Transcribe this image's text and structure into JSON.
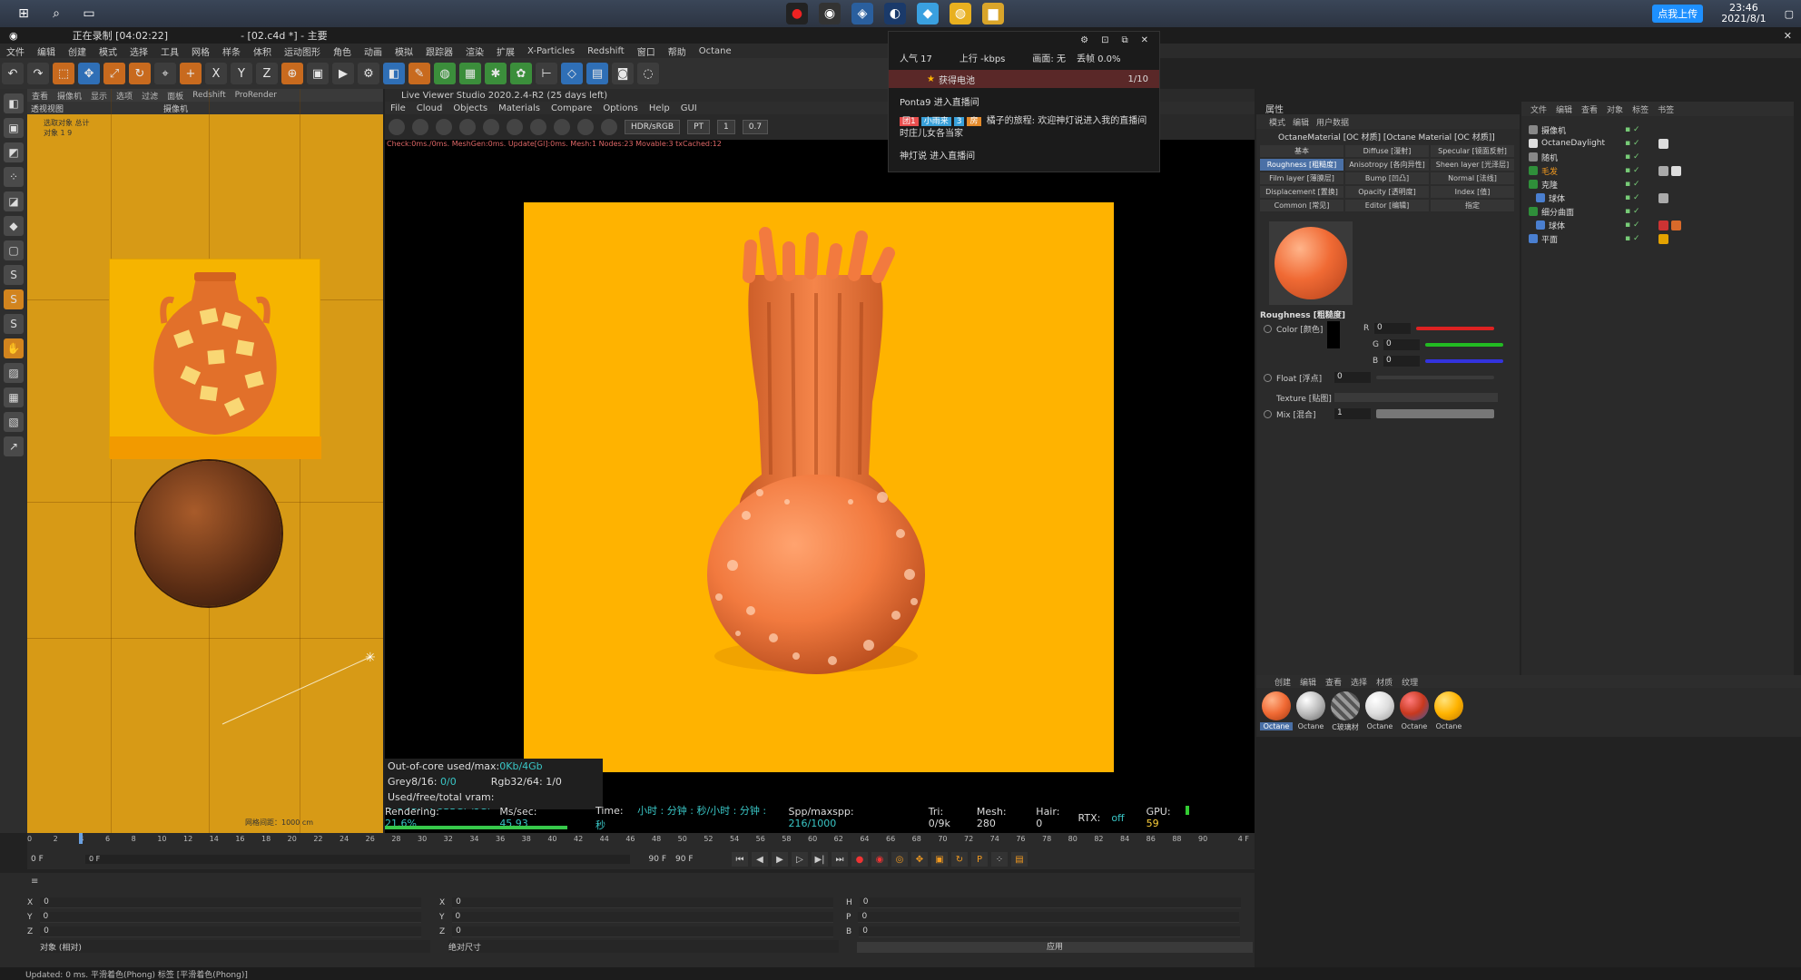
{
  "taskbar": {
    "time": "23:46",
    "date": "2021/8/1",
    "upload_label": "点我上传"
  },
  "titlebar": {
    "recording": "正在录制 [04:02:22]",
    "doc_title": "- [02.c4d *] - 主要"
  },
  "menu": [
    "文件",
    "编辑",
    "创建",
    "模式",
    "选择",
    "工具",
    "网格",
    "样条",
    "体积",
    "运动图形",
    "角色",
    "动画",
    "模拟",
    "跟踪器",
    "渲染",
    "扩展",
    "X-Particles",
    "Redshift",
    "窗口",
    "帮助",
    "Octane"
  ],
  "left_viewport": {
    "menu": [
      "查看",
      "摄像机",
      "显示",
      "选项",
      "过滤",
      "面板",
      "Redshift",
      "ProRender"
    ],
    "label": "透视视图",
    "camera": "摄像机",
    "selection_label": "选取对象 总计",
    "objects_row": "对象  1     9",
    "grid_spacing": "网格间距：1000 cm"
  },
  "viewer": {
    "title": "Live Viewer Studio 2020.2.4-R2 (25 days left)",
    "menu": [
      "File",
      "Cloud",
      "Objects",
      "Materials",
      "Compare",
      "Options",
      "Help",
      "GUI"
    ],
    "color_mode": "HDR/sRGB",
    "kernel": "PT",
    "value1": "1",
    "value2": "0.7",
    "status_line": "Check:0ms./0ms. MeshGen:0ms. Update[Gl]:0ms. Mesh:1 Nodes:23 Movable:3 txCached:12",
    "stats": {
      "out_of_core": "Out-of-core used/max:",
      "out_of_core_val": "0Kb/4Gb",
      "grey": "Grey8/16: ",
      "grey_val": "0/0",
      "rgb": "Rgb32/64: 1/0",
      "vram": "Used/free/total vram: ",
      "vram_val": "1.24Gb/4.855Gb/8Gb"
    },
    "render_bar": {
      "rendering": "Rendering: ",
      "rendering_val": "21.6%",
      "ms": "Ms/sec: ",
      "ms_val": "45.93",
      "time": "Time: ",
      "time_val": "小时 : 分钟 : 秒/小时 : 分钟 : 秒",
      "spp": "Spp/maxspp: ",
      "spp_val": "216/1000",
      "tri": "Tri: 0/9k",
      "mesh": "Mesh: 280",
      "hair": "Hair: 0",
      "rtx": "RTX:",
      "rtx_val": "off",
      "gpu": "GPU:",
      "gpu_val": "59"
    },
    "progress": 0.216
  },
  "overlay": {
    "popularity": "人气  17",
    "upload": "上行  -kbps",
    "screen": "画面: 无",
    "dropped": "丢帧 0.0%",
    "gift": "获得电池",
    "gift_count": "1/10",
    "user1": "Ponta9 进入直播间",
    "chat_tag1": "团1",
    "chat_tag2": "小雨来",
    "chat_tag3": "3",
    "chat_tag4": "房",
    "chat_msg": "橘子的旅程: 欢迎神灯说进入我的直播间时庄儿女各当家",
    "user2": "神灯说 进入直播间"
  },
  "attributes": {
    "header": "属性",
    "menu": [
      "模式",
      "编辑",
      "用户数据"
    ],
    "title": "OctaneMaterial [OC 材质] [Octane Material [OC 材质]]",
    "tabs": [
      "基本",
      "Diffuse [漫射]",
      "Specular [镜面反射]",
      "Roughness [粗糙度]",
      "Anisotropy [各向异性]",
      "Sheen layer [光泽层]",
      "Film layer [薄膜层]",
      "Bump [凹凸]",
      "Normal [法线]",
      "Displacement [置换]",
      "Opacity [透明度]",
      "Index [值]",
      "Common [常见]",
      "Editor [编辑]",
      "指定"
    ],
    "section": "Roughness [粗糙度]",
    "color_label": "Color [颜色]",
    "r": "R",
    "g": "G",
    "b": "B",
    "rv": "0",
    "gv": "0",
    "bv": "0",
    "float_label": "Float [浮点]",
    "float_val": "0",
    "texture_label": "Texture [贴图]",
    "mix_label": "Mix [混合]",
    "mix_val": "1"
  },
  "objects": {
    "menu": [
      "文件",
      "编辑",
      "查看",
      "对象",
      "标签",
      "书签"
    ],
    "rows": [
      "摄像机",
      "OctaneDaylight",
      "随机",
      "毛发",
      "克隆",
      "球体",
      "细分曲面",
      "球体",
      "平面"
    ]
  },
  "material_strip": {
    "menu": [
      "创建",
      "编辑",
      "查看",
      "选择",
      "材质",
      "纹理"
    ],
    "slots": [
      "Octane",
      "Octane",
      "C玻璃材",
      "Octane",
      "Octane",
      "Octane"
    ]
  },
  "timeline": {
    "ticks": [
      "0",
      "2",
      "4",
      "6",
      "8",
      "10",
      "12",
      "14",
      "16",
      "18",
      "20",
      "22",
      "24",
      "26",
      "28",
      "30",
      "32",
      "34",
      "36",
      "38",
      "40",
      "42",
      "44",
      "46",
      "48",
      "50",
      "52",
      "54",
      "56",
      "58",
      "60",
      "62",
      "64",
      "66",
      "68",
      "70",
      "72",
      "74",
      "76",
      "78",
      "80",
      "82",
      "84",
      "86",
      "88",
      "90"
    ],
    "current": "4 F",
    "start": "0 F",
    "start2": "0 F",
    "end": "90 F",
    "end2": "90 F"
  },
  "coords": {
    "x": "X",
    "y": "Y",
    "z": "Z",
    "h": "H",
    "p": "P",
    "b": "B",
    "v0": "0",
    "mode1": "对象 (相对)",
    "mode2": "绝对尺寸",
    "apply": "应用"
  },
  "status": "Updated: 0 ms.   平滑着色(Phong) 标签 [平滑着色(Phong)]",
  "colors": {
    "render_bg": "#ffb300",
    "vase": "#f27a3f",
    "accent": "#4a70a6"
  }
}
